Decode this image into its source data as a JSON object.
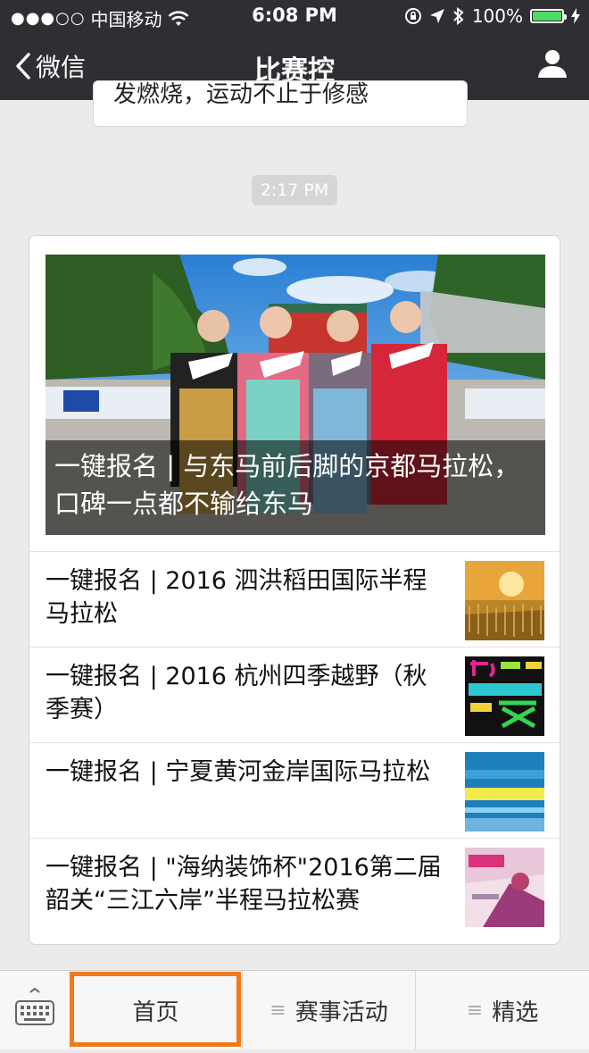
{
  "status_bar": {
    "carrier": "中国移动",
    "signal_dots": "●●●○○",
    "time": "6:08 PM",
    "battery": "100%"
  },
  "nav": {
    "back_label": "微信",
    "title": "比赛控"
  },
  "chat": {
    "prev_bubble_text": "发燃烧，运动不止于修感",
    "timestamp": "2:17 PM"
  },
  "article": {
    "hero_title": "一键报名 | 与东马前后脚的京都马拉松，口碑一点都不输给东马",
    "items": [
      {
        "title": "一键报名 | 2016 泗洪稻田国际半程马拉松"
      },
      {
        "title": "一键报名 | 2016 杭州四季越野（秋季赛）"
      },
      {
        "title": "一键报名 | 宁夏黄河金岸国际马拉松"
      },
      {
        "title": "一键报名 | \"海纳装饰杯\"2016第二届韶关“三江六岸”半程马拉松赛"
      }
    ]
  },
  "bottom_menu": {
    "items": [
      {
        "label": "首页"
      },
      {
        "label": "赛事活动"
      },
      {
        "label": "精选"
      }
    ],
    "highlight_color": "#f07b1b"
  }
}
